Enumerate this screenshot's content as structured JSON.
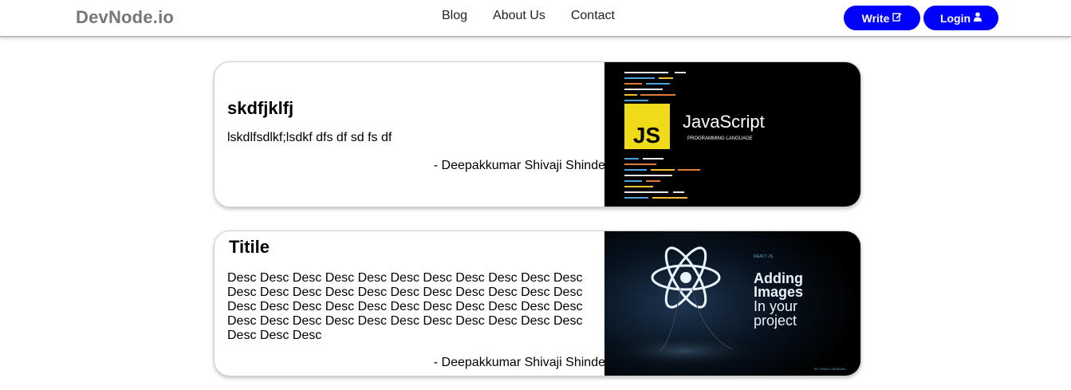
{
  "navbar": {
    "brand": "DevNode.io",
    "links": [
      "Blog",
      "About Us",
      "Contact"
    ],
    "write_label": "Write",
    "login_label": "Login",
    "write_icon": "edit-icon",
    "login_icon": "user-icon",
    "accent_color": "#0000ff"
  },
  "posts": [
    {
      "title": "skdfjklfj",
      "desc": "lskdlfsdlkf;lsdkf dfs df sd fs df",
      "author": "- Deepakkumar Shivaji Shinde",
      "image": {
        "logo_text": "JS",
        "heading": "JavaScript",
        "subheading": "PROGRAMMING LANGUAGE"
      }
    },
    {
      "title": "Titile",
      "desc": "Desc Desc Desc Desc Desc Desc Desc Desc Desc Desc Desc Desc Desc Desc Desc Desc Desc Desc Desc Desc Desc Desc Desc Desc Desc Desc Desc Desc Desc Desc Desc Desc Desc Desc Desc Desc Desc Desc Desc Desc Desc Desc Desc Desc Desc Desc Desc",
      "author": "- Deepakkumar Shivaji Shinde",
      "image": {
        "kicker": "REACT JS",
        "line1": "Adding",
        "line2": "Images",
        "line3": "In your",
        "line4": "project",
        "credit": "BY VITALIY DEMYAN"
      }
    }
  ]
}
